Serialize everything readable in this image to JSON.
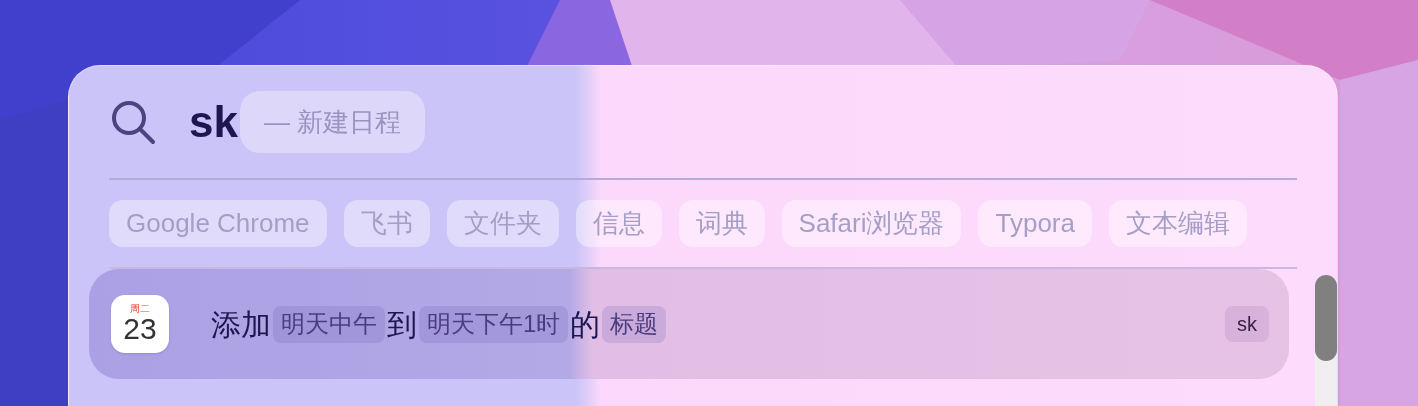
{
  "search": {
    "value": "sk",
    "suggestion": "— 新建日程"
  },
  "apps": [
    {
      "label": "Google Chrome"
    },
    {
      "label": "飞书"
    },
    {
      "label": "文件夹"
    },
    {
      "label": "信息"
    },
    {
      "label": "词典"
    },
    {
      "label": "Safari浏览器"
    },
    {
      "label": "Typora"
    },
    {
      "label": "文本编辑"
    }
  ],
  "results": [
    {
      "selected": true,
      "icon_day": "周二",
      "icon_date": "23",
      "shortcut": "sk",
      "parts": [
        {
          "kind": "text",
          "text": "添加"
        },
        {
          "kind": "token",
          "text": "明天中午"
        },
        {
          "kind": "text",
          "text": "到"
        },
        {
          "kind": "token",
          "text": "明天下午1时"
        },
        {
          "kind": "text",
          "text": "的"
        },
        {
          "kind": "token",
          "text": "标题"
        }
      ]
    }
  ]
}
